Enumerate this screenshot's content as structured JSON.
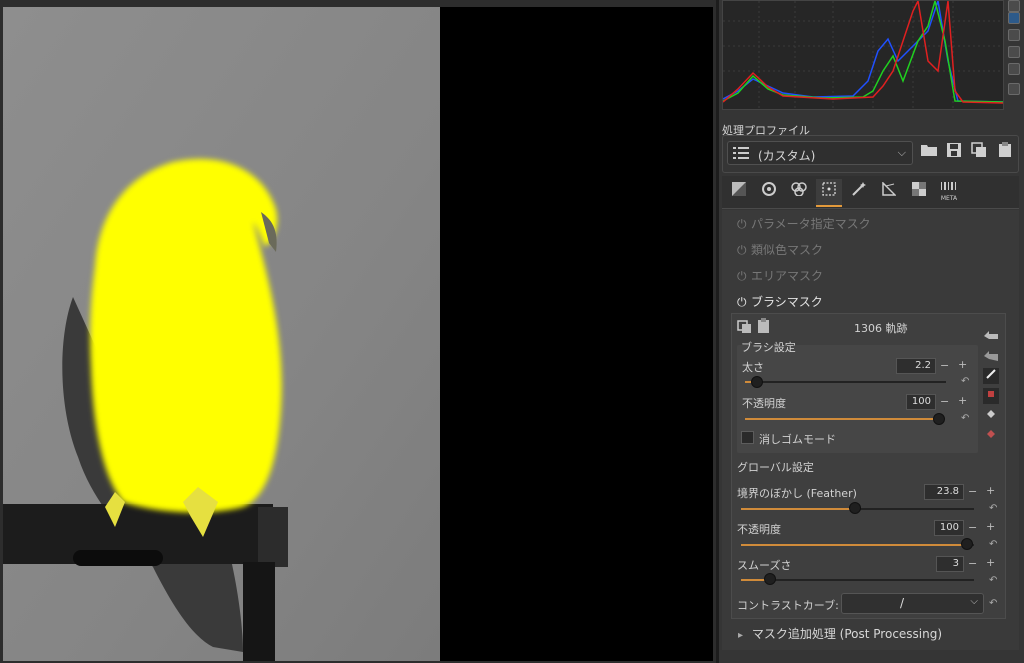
{
  "profile": {
    "section_title": "処理プロファイル",
    "selected": "(カスタム)"
  },
  "tabs": [
    {
      "name": "exposure-tab"
    },
    {
      "name": "detail-tab"
    },
    {
      "name": "color-tab"
    },
    {
      "name": "local-tab"
    },
    {
      "name": "advanced-tab"
    },
    {
      "name": "transform-tab"
    },
    {
      "name": "raw-tab"
    },
    {
      "name": "meta-tab",
      "label": "META"
    }
  ],
  "masks": {
    "parametric": "パラメータ指定マスク",
    "color_range": "類似色マスク",
    "area": "エリアマスク",
    "brush": "ブラシマスク"
  },
  "brush": {
    "stroke_count": "1306 軌跡",
    "settings_title": "ブラシ設定",
    "size": {
      "label": "太さ",
      "value": "2.2",
      "fraction": 0.06
    },
    "opacity": {
      "label": "不透明度",
      "value": "100",
      "fraction": 1.0
    },
    "eraser": {
      "label": "消しゴムモード",
      "checked": false
    }
  },
  "global": {
    "title": "グローバル設定",
    "feather": {
      "label": "境界のぼかし (Feather)",
      "value": "23.8",
      "fraction": 0.49
    },
    "opacity": {
      "label": "不透明度",
      "value": "100",
      "fraction": 1.0
    },
    "smoothness": {
      "label": "スムーズさ",
      "value": "3",
      "fraction": 0.1
    },
    "contrast_curve": {
      "label": "コントラストカーブ:",
      "value": "/"
    }
  },
  "post_processing": "マスク追加処理 (Post Processing)",
  "colors": {
    "accent": "#d08b3a",
    "mask_overlay": "#ffff00",
    "histogram_red": "#e02020",
    "histogram_green": "#20d020",
    "histogram_blue": "#2050ff"
  },
  "symbols": {
    "power": "⏻",
    "plus": "+",
    "minus": "−",
    "reset": "↶",
    "chevron_down": "⌵",
    "expander": "▸"
  }
}
